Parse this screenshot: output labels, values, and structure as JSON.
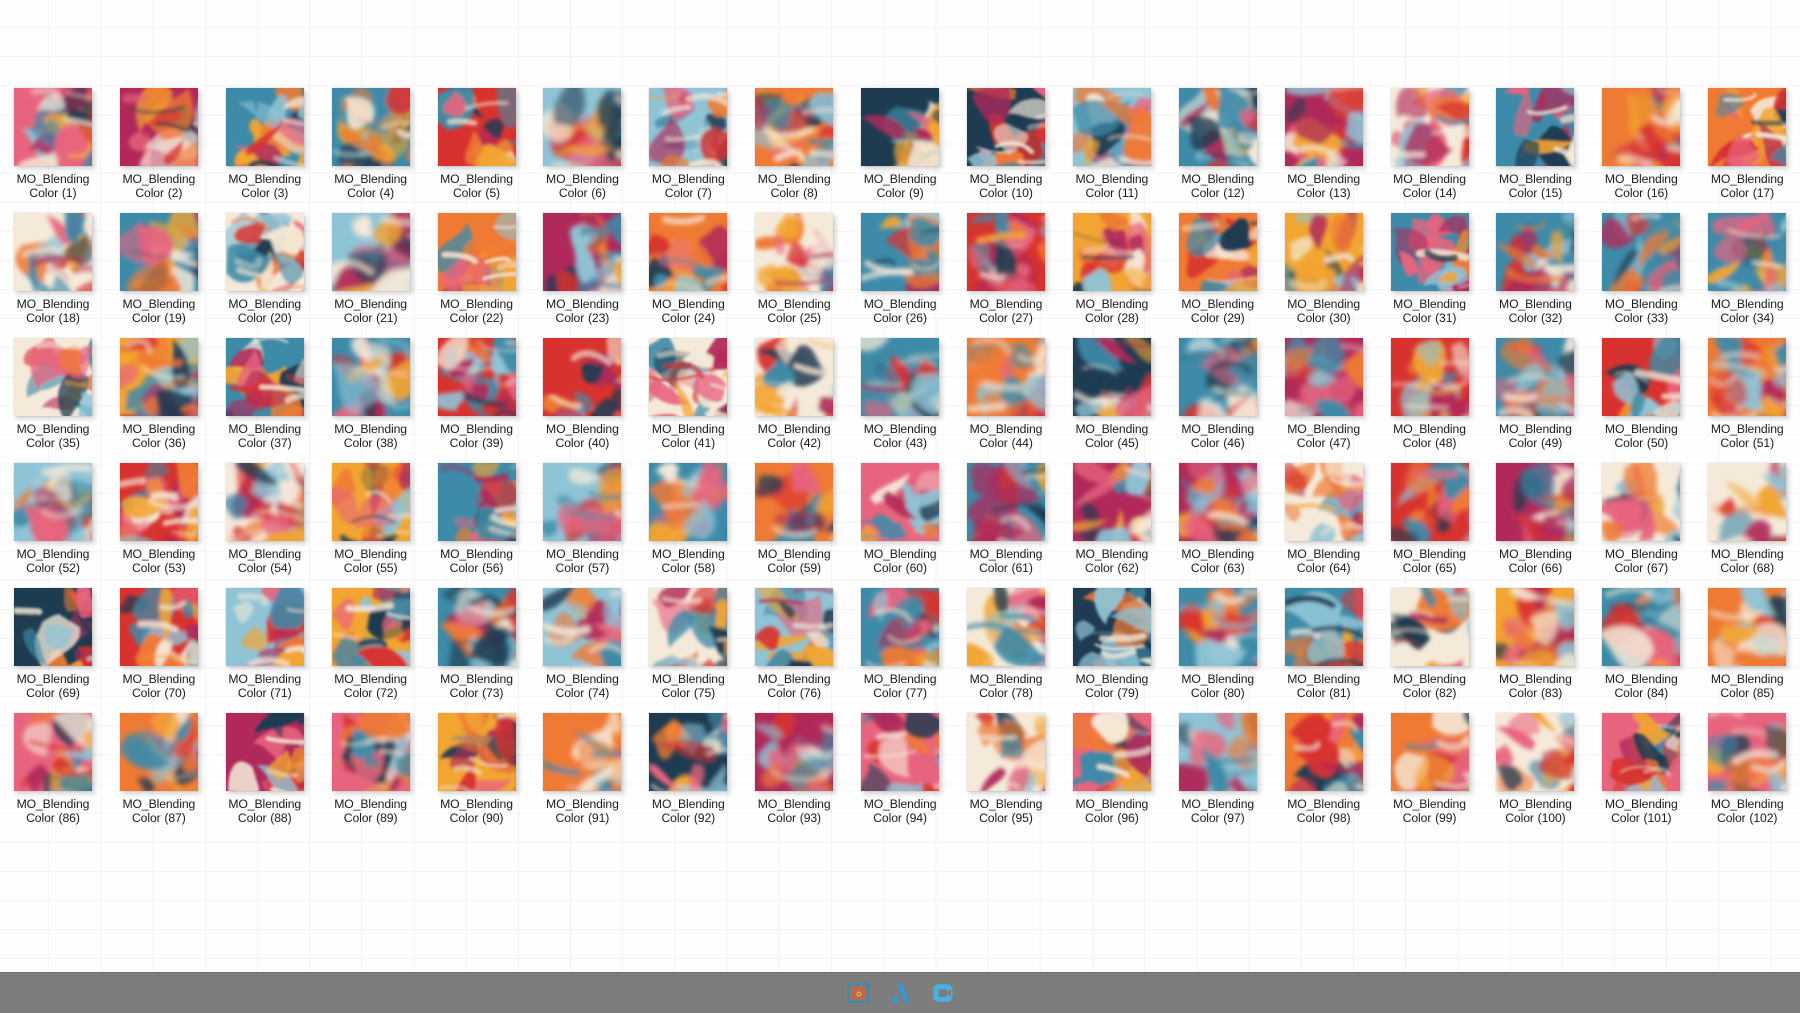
{
  "window": {
    "view_mode": "medium-icons-grid",
    "columns": 17,
    "rows": 6,
    "total_items": 102,
    "background_color": "#fefefe",
    "grid_line_color": "#f0f0f0",
    "label_color": "#1b1b1b"
  },
  "files": {
    "name_prefix": "MO_Blending",
    "name_second_line_prefix": "Color",
    "labels": [
      [
        "MO_Blending",
        "Color  (1)"
      ],
      [
        "MO_Blending",
        "Color  (2)"
      ],
      [
        "MO_Blending",
        "Color  (3)"
      ],
      [
        "MO_Blending",
        "Color  (4)"
      ],
      [
        "MO_Blending",
        "Color  (5)"
      ],
      [
        "MO_Blending",
        "Color  (6)"
      ],
      [
        "MO_Blending",
        "Color  (7)"
      ],
      [
        "MO_Blending",
        "Color  (8)"
      ],
      [
        "MO_Blending",
        "Color  (9)"
      ],
      [
        "MO_Blending",
        "Color  (10)"
      ],
      [
        "MO_Blending",
        "Color  (11)"
      ],
      [
        "MO_Blending",
        "Color  (12)"
      ],
      [
        "MO_Blending",
        "Color  (13)"
      ],
      [
        "MO_Blending",
        "Color  (14)"
      ],
      [
        "MO_Blending",
        "Color  (15)"
      ],
      [
        "MO_Blending",
        "Color  (16)"
      ],
      [
        "MO_Blending",
        "Color  (17)"
      ],
      [
        "MO_Blending",
        "Color  (18)"
      ],
      [
        "MO_Blending",
        "Color  (19)"
      ],
      [
        "MO_Blending",
        "Color  (20)"
      ],
      [
        "MO_Blending",
        "Color  (21)"
      ],
      [
        "MO_Blending",
        "Color  (22)"
      ],
      [
        "MO_Blending",
        "Color  (23)"
      ],
      [
        "MO_Blending",
        "Color  (24)"
      ],
      [
        "MO_Blending",
        "Color  (25)"
      ],
      [
        "MO_Blending",
        "Color  (26)"
      ],
      [
        "MO_Blending",
        "Color  (27)"
      ],
      [
        "MO_Blending",
        "Color  (28)"
      ],
      [
        "MO_Blending",
        "Color  (29)"
      ],
      [
        "MO_Blending",
        "Color  (30)"
      ],
      [
        "MO_Blending",
        "Color  (31)"
      ],
      [
        "MO_Blending",
        "Color  (32)"
      ],
      [
        "MO_Blending",
        "Color  (33)"
      ],
      [
        "MO_Blending",
        "Color  (34)"
      ],
      [
        "MO_Blending",
        "Color  (35)"
      ],
      [
        "MO_Blending",
        "Color  (36)"
      ],
      [
        "MO_Blending",
        "Color  (37)"
      ],
      [
        "MO_Blending",
        "Color  (38)"
      ],
      [
        "MO_Blending",
        "Color  (39)"
      ],
      [
        "MO_Blending",
        "Color  (40)"
      ],
      [
        "MO_Blending",
        "Color  (41)"
      ],
      [
        "MO_Blending",
        "Color  (42)"
      ],
      [
        "MO_Blending",
        "Color  (43)"
      ],
      [
        "MO_Blending",
        "Color  (44)"
      ],
      [
        "MO_Blending",
        "Color  (45)"
      ],
      [
        "MO_Blending",
        "Color  (46)"
      ],
      [
        "MO_Blending",
        "Color  (47)"
      ],
      [
        "MO_Blending",
        "Color  (48)"
      ],
      [
        "MO_Blending",
        "Color  (49)"
      ],
      [
        "MO_Blending",
        "Color  (50)"
      ],
      [
        "MO_Blending",
        "Color  (51)"
      ],
      [
        "MO_Blending",
        "Color  (52)"
      ],
      [
        "MO_Blending",
        "Color  (53)"
      ],
      [
        "MO_Blending",
        "Color  (54)"
      ],
      [
        "MO_Blending",
        "Color  (55)"
      ],
      [
        "MO_Blending",
        "Color  (56)"
      ],
      [
        "MO_Blending",
        "Color  (57)"
      ],
      [
        "MO_Blending",
        "Color  (58)"
      ],
      [
        "MO_Blending",
        "Color  (59)"
      ],
      [
        "MO_Blending",
        "Color  (60)"
      ],
      [
        "MO_Blending",
        "Color  (61)"
      ],
      [
        "MO_Blending",
        "Color  (62)"
      ],
      [
        "MO_Blending",
        "Color  (63)"
      ],
      [
        "MO_Blending",
        "Color  (64)"
      ],
      [
        "MO_Blending",
        "Color  (65)"
      ],
      [
        "MO_Blending",
        "Color  (66)"
      ],
      [
        "MO_Blending",
        "Color  (67)"
      ],
      [
        "MO_Blending",
        "Color  (68)"
      ],
      [
        "MO_Blending",
        "Color  (69)"
      ],
      [
        "MO_Blending",
        "Color  (70)"
      ],
      [
        "MO_Blending",
        "Color  (71)"
      ],
      [
        "MO_Blending",
        "Color  (72)"
      ],
      [
        "MO_Blending",
        "Color  (73)"
      ],
      [
        "MO_Blending",
        "Color  (74)"
      ],
      [
        "MO_Blending",
        "Color  (75)"
      ],
      [
        "MO_Blending",
        "Color  (76)"
      ],
      [
        "MO_Blending",
        "Color  (77)"
      ],
      [
        "MO_Blending",
        "Color  (78)"
      ],
      [
        "MO_Blending",
        "Color  (79)"
      ],
      [
        "MO_Blending",
        "Color  (80)"
      ],
      [
        "MO_Blending",
        "Color  (81)"
      ],
      [
        "MO_Blending",
        "Color  (82)"
      ],
      [
        "MO_Blending",
        "Color  (83)"
      ],
      [
        "MO_Blending",
        "Color  (84)"
      ],
      [
        "MO_Blending",
        "Color  (85)"
      ],
      [
        "MO_Blending",
        "Color  (86)"
      ],
      [
        "MO_Blending",
        "Color  (87)"
      ],
      [
        "MO_Blending",
        "Color  (88)"
      ],
      [
        "MO_Blending",
        "Color  (89)"
      ],
      [
        "MO_Blending",
        "Color  (90)"
      ],
      [
        "MO_Blending",
        "Color  (91)"
      ],
      [
        "MO_Blending",
        "Color  (92)"
      ],
      [
        "MO_Blending",
        "Color  (93)"
      ],
      [
        "MO_Blending",
        "Color  (94)"
      ],
      [
        "MO_Blending",
        "Color  (95)"
      ],
      [
        "MO_Blending",
        "Color  (96)"
      ],
      [
        "MO_Blending",
        "Color  (97)"
      ],
      [
        "MO_Blending",
        "Color  (98)"
      ],
      [
        "MO_Blending",
        "Color  (99)"
      ],
      [
        "MO_Blending",
        "Color  (100)"
      ],
      [
        "MO_Blending",
        "Color  (101)"
      ],
      [
        "MO_Blending",
        "Color  (102)"
      ]
    ],
    "thumbnail_palette": {
      "teal": "#3d8ba8",
      "deep_navy": "#1d3b51",
      "amber": "#f2a531",
      "orange": "#ef7a33",
      "crimson": "#d8322f",
      "pink": "#e8647e",
      "magenta": "#b0295a",
      "cream": "#f5ead9",
      "sky": "#8fc4d6"
    },
    "thumbnail_description": "abstract blended paint artwork"
  },
  "taskbar": {
    "background_color": "#7d7d7d",
    "icons": [
      {
        "name": "maze-game-icon",
        "label": "Maze Game"
      },
      {
        "name": "arc-browser-icon",
        "label": "Arc"
      },
      {
        "name": "camera-app-icon",
        "label": "Camera"
      }
    ]
  }
}
